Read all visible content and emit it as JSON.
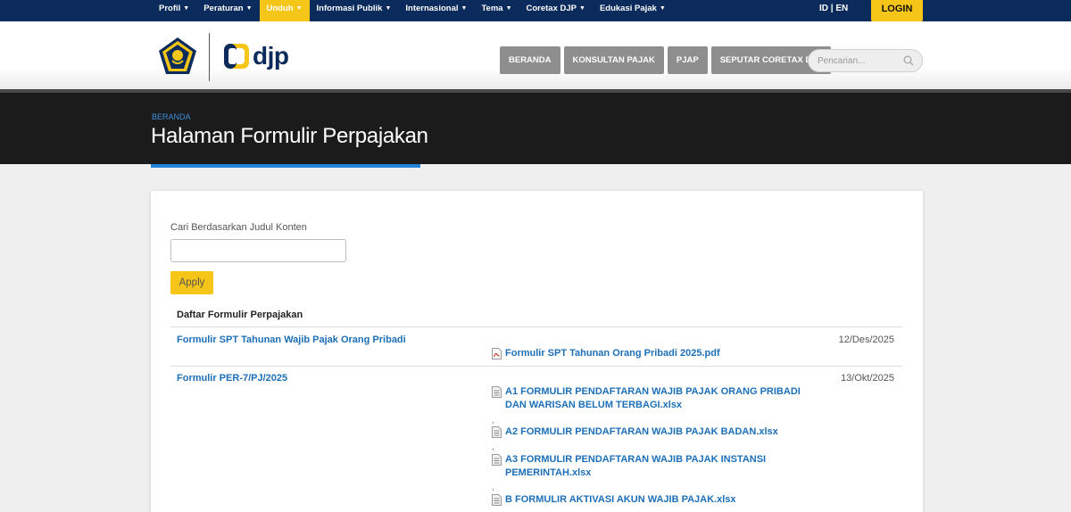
{
  "topnav": {
    "menu": [
      {
        "label": "Profil",
        "active": false
      },
      {
        "label": "Peraturan",
        "active": false
      },
      {
        "label": "Unduh",
        "active": true
      },
      {
        "label": "Informasi Publik",
        "active": false
      },
      {
        "label": "Internasional",
        "active": false
      },
      {
        "label": "Tema",
        "active": false
      },
      {
        "label": "Coretax DJP",
        "active": false
      },
      {
        "label": "Edukasi Pajak",
        "active": false
      }
    ],
    "lang_id": "ID",
    "lang_sep": "|",
    "lang_en": "EN",
    "login": "LOGIN"
  },
  "header": {
    "logo_text": "djp",
    "nav": [
      "BERANDA",
      "KONSULTAN PAJAK",
      "PJAP",
      "SEPUTAR CORETAX DJP"
    ],
    "search_placeholder": "Pencarian..."
  },
  "banner": {
    "breadcrumb": "BERANDA",
    "title": "Halaman Formulir Perpajakan"
  },
  "filter": {
    "label": "Cari Berdasarkan Judul Konten",
    "value": "",
    "apply": "Apply"
  },
  "list": {
    "heading": "Daftar Formulir Perpajakan",
    "items": [
      {
        "title": "Formulir SPT Tahunan Wajib Pajak Orang Pribadi",
        "date": "12/Des/2025",
        "files": [
          {
            "name": "Formulir SPT Tahunan Orang Pribadi 2025.pdf",
            "type": "pdf"
          }
        ]
      },
      {
        "title": "Formulir PER-7/PJ/2025",
        "date": "13/Okt/2025",
        "files": [
          {
            "name": "A1 FORMULIR PENDAFTARAN WAJIB PAJAK ORANG PRIBADI DAN WARISAN BELUM TERBAGI.xlsx",
            "type": "xlsx"
          },
          {
            "name": "A2 FORMULIR PENDAFTARAN WAJIB PAJAK BADAN.xlsx",
            "type": "xlsx"
          },
          {
            "name": "A3 FORMULIR PENDAFTARAN WAJIB PAJAK INSTANSI PEMERINTAH.xlsx",
            "type": "xlsx"
          },
          {
            "name": "B FORMULIR AKTIVASI AKUN WAJIB PAJAK.xlsx",
            "type": "xlsx"
          }
        ],
        "separator": ","
      }
    ]
  },
  "colors": {
    "topnav_bg": "#0a2b5c",
    "accent_yellow": "#f5c518",
    "link_blue": "#1d6fb8",
    "banner_bg": "#1b1b1b",
    "banner_underline": "#1f83d8"
  },
  "icons": [
    "caret-down-icon",
    "emblem-logo",
    "djp-logo-icon",
    "search-icon",
    "pdf-file-icon",
    "xlsx-file-icon"
  ]
}
